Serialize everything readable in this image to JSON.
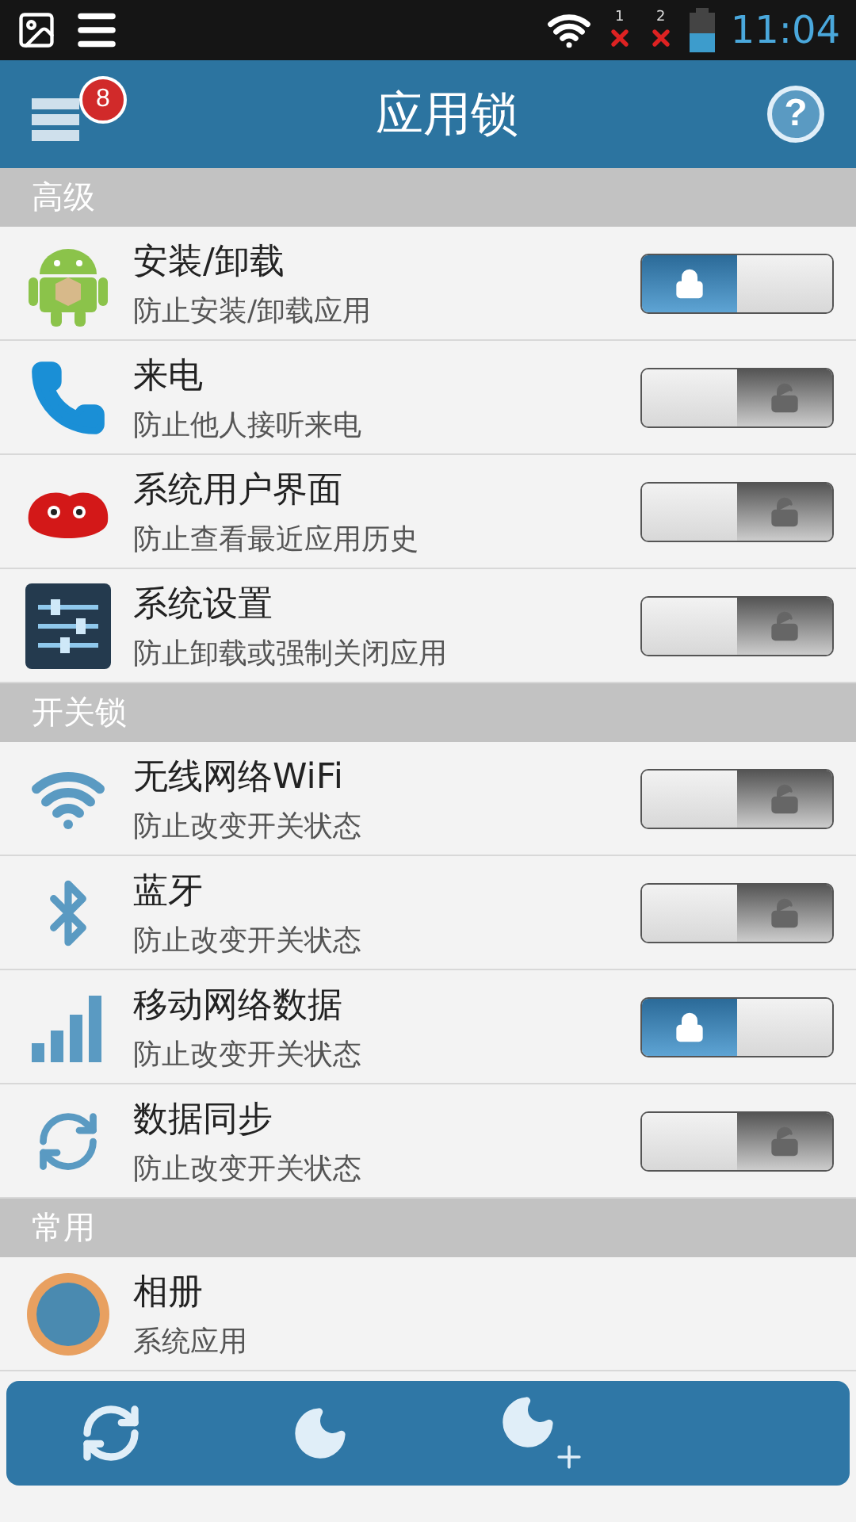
{
  "status_bar": {
    "sim_1": "1",
    "sim_2": "2",
    "time": "11:04"
  },
  "header": {
    "title": "应用锁",
    "badge": "8",
    "help": "?"
  },
  "sections": [
    {
      "title": "高级",
      "items": [
        {
          "kind": "android",
          "title": "安装/卸载",
          "subtitle": "防止安装/卸载应用",
          "on": true
        },
        {
          "kind": "phone",
          "title": "来电",
          "subtitle": "防止他人接听来电",
          "on": false
        },
        {
          "kind": "jellybean",
          "title": "系统用户界面",
          "subtitle": "防止查看最近应用历史",
          "on": false
        },
        {
          "kind": "settings",
          "title": "系统设置",
          "subtitle": "防止卸载或强制关闭应用",
          "on": false
        }
      ]
    },
    {
      "title": "开关锁",
      "items": [
        {
          "kind": "wifi",
          "title": "无线网络WiFi",
          "subtitle": "防止改变开关状态",
          "on": false
        },
        {
          "kind": "bluetooth",
          "title": "蓝牙",
          "subtitle": "防止改变开关状态",
          "on": false
        },
        {
          "kind": "signal",
          "title": "移动网络数据",
          "subtitle": "防止改变开关状态",
          "on": true
        },
        {
          "kind": "sync",
          "title": "数据同步",
          "subtitle": "防止改变开关状态",
          "on": false
        }
      ]
    },
    {
      "title": "常用",
      "items": [
        {
          "kind": "gallery",
          "title": "相册",
          "subtitle": "系统应用"
        }
      ]
    }
  ]
}
